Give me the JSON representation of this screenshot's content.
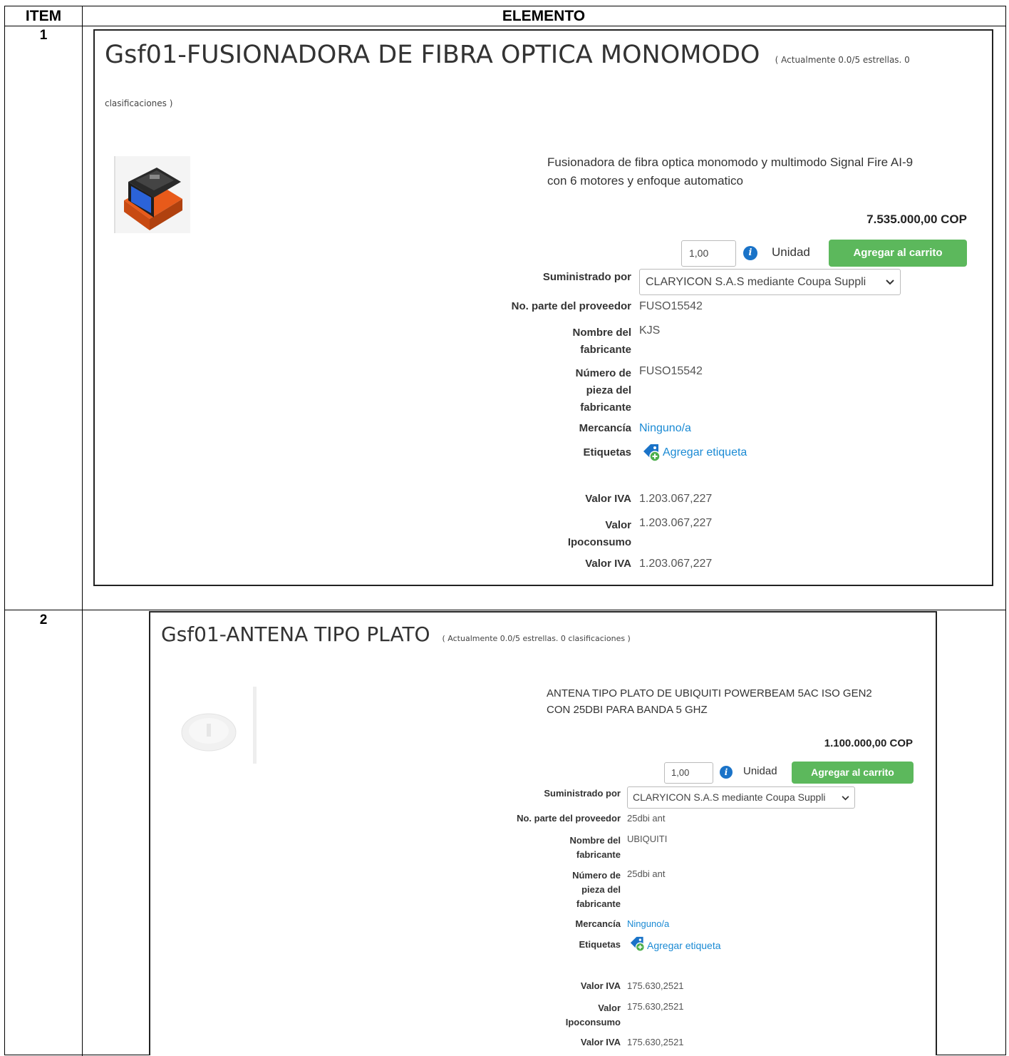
{
  "table": {
    "header_item": "ITEM",
    "header_element": "ELEMENTO"
  },
  "items": [
    {
      "number": "1",
      "title": "Gsf01-FUSIONADORA DE FIBRA OPTICA MONOMODO",
      "rating_part1": "( Actualmente 0.0/5 estrellas. 0",
      "rating_part2": "clasificaciones )",
      "image_icon": "fusion-splicer-image",
      "description_line1": "Fusionadora de fibra optica monomodo y multimodo Signal Fire AI-9",
      "description_line2": "con 6 motores y enfoque automatico",
      "price": "7.535.000,00 COP",
      "quantity": "1,00",
      "unit": "Unidad",
      "add_to_cart": "Agregar al carrito",
      "supplied_by_label": "Suministrado por",
      "supplier": "CLARYICON S.A.S mediante Coupa Suppli",
      "supplier_part_label": "No. parte del proveedor",
      "supplier_part": "FUSO15542",
      "manufacturer_label_1": "Nombre del",
      "manufacturer_label_2": "fabricante",
      "manufacturer": "KJS",
      "mfr_part_label_1": "Número de",
      "mfr_part_label_2": "pieza del",
      "mfr_part_label_3": "fabricante",
      "mfr_part": "FUSO15542",
      "commodity_label": "Mercancía",
      "commodity": "Ninguno/a",
      "tags_label": "Etiquetas",
      "add_tag": "Agregar etiqueta",
      "iva_label": "Valor IVA",
      "iva": "1.203.067,227",
      "ipo_label_1": "Valor",
      "ipo_label_2": "Ipoconsumo",
      "ipo": "1.203.067,227",
      "iva2_label": "Valor IVA",
      "iva2": "1.203.067,227"
    },
    {
      "number": "2",
      "title": "Gsf01-ANTENA TIPO PLATO",
      "rating": "( Actualmente 0.0/5 estrellas. 0 clasificaciones )",
      "image_icon": "dish-antenna-image",
      "description_line1": "ANTENA TIPO PLATO DE UBIQUITI POWERBEAM 5AC ISO GEN2",
      "description_line2": "CON 25DBI PARA BANDA 5 GHZ",
      "price": "1.100.000,00 COP",
      "quantity": "1,00",
      "unit": "Unidad",
      "add_to_cart": "Agregar al carrito",
      "supplied_by_label": "Suministrado por",
      "supplier": "CLARYICON S.A.S mediante Coupa Suppli",
      "supplier_part_label": "No. parte del proveedor",
      "supplier_part": "25dbi ant",
      "manufacturer_label_1": "Nombre del",
      "manufacturer_label_2": "fabricante",
      "manufacturer": "UBIQUITI",
      "mfr_part_label_1": "Número de",
      "mfr_part_label_2": "pieza del",
      "mfr_part_label_3": "fabricante",
      "mfr_part": "25dbi ant",
      "commodity_label": "Mercancía",
      "commodity": "Ninguno/a",
      "tags_label": "Etiquetas",
      "add_tag": "Agregar etiqueta",
      "iva_label": "Valor IVA",
      "iva": "175.630,2521",
      "ipo_label_1": "Valor",
      "ipo_label_2": "Ipoconsumo",
      "ipo": "175.630,2521",
      "iva2_label": "Valor IVA",
      "iva2": "175.630,2521"
    }
  ],
  "colors": {
    "button_green": "#5cb85c",
    "link_blue": "#1a8ad4",
    "info_blue": "#1a73c8",
    "tag_green": "#4cae4c"
  },
  "icons": [
    "info-icon",
    "chevron-down-icon",
    "tag-add-icon"
  ]
}
